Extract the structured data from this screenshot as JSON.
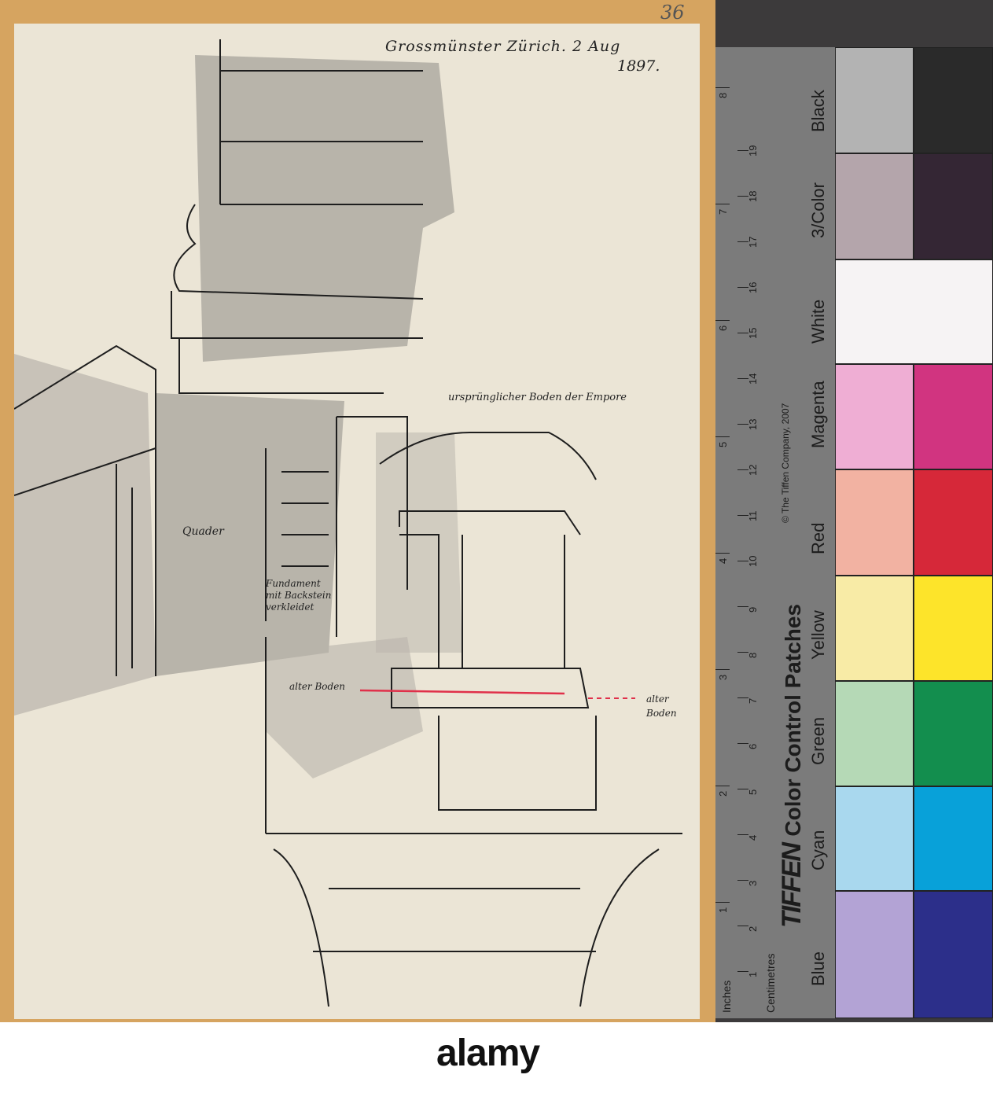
{
  "sheet_number": "36",
  "drawing": {
    "title": "Grossmünster Zürich. 2 Aug",
    "year": "1897.",
    "labels": {
      "boden_empore": "ursprünglicher Boden der Empore",
      "quader": "Quader",
      "fundament": [
        "Fundament",
        "mit Backstein",
        "verkleidet"
      ],
      "alter_boden_left": "alter Boden",
      "alter_boden_right": [
        "alter",
        "Boden"
      ]
    }
  },
  "color_chart": {
    "brand": "TIFFEN",
    "title": "Color Control Patches",
    "copyright": "© The Tiffen Company, 2007",
    "inches_label": "Inches",
    "cm_label": "Centimetres",
    "inch_ticks": [
      "1",
      "2",
      "3",
      "4",
      "5",
      "6",
      "7",
      "8"
    ],
    "cm_ticks": [
      "1",
      "2",
      "3",
      "4",
      "5",
      "6",
      "7",
      "8",
      "9",
      "10",
      "11",
      "12",
      "13",
      "14",
      "15",
      "16",
      "17",
      "18",
      "19"
    ],
    "patches": [
      {
        "name": "Black",
        "light": "#b3b3b3",
        "dark": "#2a2a2a"
      },
      {
        "name": "3/Color",
        "light": "#b4a5ab",
        "dark": "#342634"
      },
      {
        "name": "White",
        "light": "#f6f3f4",
        "dark": "#f6f3f4"
      },
      {
        "name": "Magenta",
        "light": "#efaed4",
        "dark": "#d13480"
      },
      {
        "name": "Red",
        "light": "#f2b2a2",
        "dark": "#d62839"
      },
      {
        "name": "Yellow",
        "light": "#f8eba6",
        "dark": "#fde42a"
      },
      {
        "name": "Green",
        "light": "#b5d9b6",
        "dark": "#138e4e"
      },
      {
        "name": "Cyan",
        "light": "#a9d8ee",
        "dark": "#08a1d9"
      },
      {
        "name": "Blue",
        "light": "#b3a3d5",
        "dark": "#2c2f8a"
      }
    ]
  },
  "watermark": "alamy"
}
